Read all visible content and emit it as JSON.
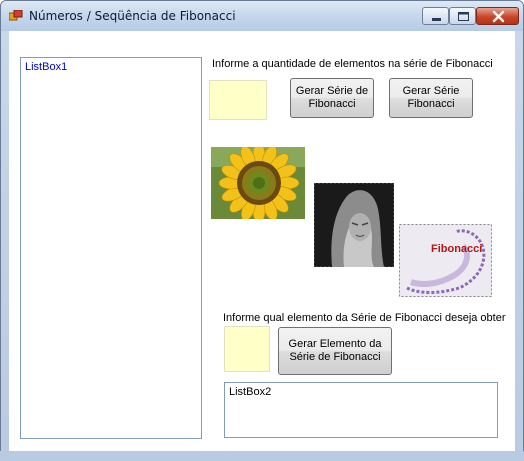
{
  "window": {
    "title": "Números / Seqüência de Fibonacci",
    "controls": {
      "minimize": "minimize",
      "maximize": "maximize",
      "close": "close"
    }
  },
  "listbox1": {
    "text": "ListBox1"
  },
  "listbox2": {
    "text": "ListBox2"
  },
  "series_section": {
    "label": "Informe a quantidade de elementos na série de Fibonacci",
    "input_value": "",
    "button1_label": "Gerar Série de Fibonacci",
    "button2_label": "Gerar Série Fibonacci"
  },
  "element_section": {
    "label": "Informe qual elemento da Série de Fibonacci deseja obter",
    "input_value": "",
    "button_label": "Gerar Elemento da Série de Fibonacci"
  },
  "images": {
    "sunflower": "sunflower-image",
    "statue": "fibonacci-statue-image",
    "spiral": "fibonacci-spiral-image",
    "spiral_caption": "Fibonacci"
  },
  "colors": {
    "input_background": "#ffffc8",
    "listbox1_text": "#0000cc"
  }
}
